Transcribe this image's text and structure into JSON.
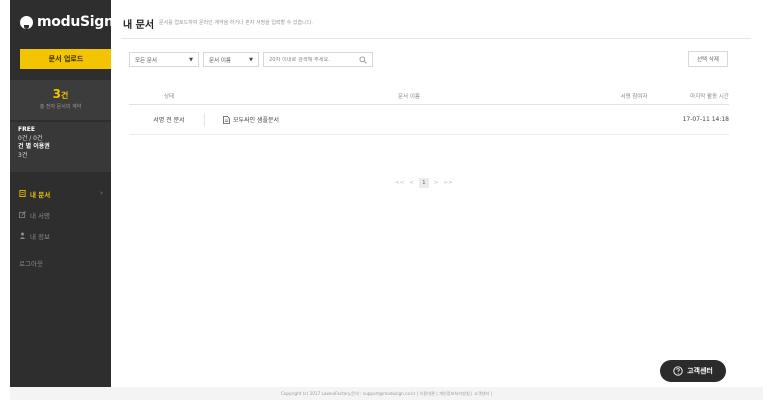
{
  "sidebar": {
    "logo_text": "moduSign",
    "upload_button": "문서 업로드",
    "stats": {
      "count": "3",
      "unit": "건",
      "label": "총 전자 문서의 계약"
    },
    "plan": {
      "name": "FREE",
      "usage": "0건 / 0건",
      "monthly_label": "건 별 이용권",
      "monthly_value": "3건"
    },
    "nav": [
      {
        "label": "내 문서",
        "icon": "document-icon",
        "active": true
      },
      {
        "label": "내 서명",
        "icon": "signature-pen-icon",
        "active": false
      },
      {
        "label": "내 정보",
        "icon": "user-icon",
        "active": false
      }
    ],
    "logout": "로그아웃"
  },
  "main": {
    "title": "내 문서",
    "subtitle": "문서를 업로드하여 온라인 계약을 하거나 혼자 서명을 입력할 수 있습니다.",
    "filters": {
      "status_select": "모든 문서",
      "field_select": "문서 이름",
      "search_placeholder": "20자 이내로 검색해 주세요."
    },
    "delete_button": "선택 삭제",
    "table": {
      "headers": {
        "status": "상태",
        "name": "문서 이름",
        "signer": "서명 참여자",
        "activity": "마지막 활동 시간"
      },
      "rows": [
        {
          "status": "서명 전 문서",
          "name": "모두싸인 샘플문서",
          "signer": "",
          "activity": "17-07-11 14:18"
        }
      ]
    },
    "pagination": {
      "first": "<<",
      "prev": "<",
      "current": "1",
      "next": ">",
      "last": ">>"
    }
  },
  "help_button": "고객센터",
  "footer": {
    "copyright": "Copyright (c) 2017 LawnoFactory.문의 : support@modusign.co.kr",
    "links": [
      "이용약관",
      "개인정보처리방침",
      "고객센터"
    ]
  },
  "colors": {
    "accent": "#f2c500",
    "sidebar_bg": "#2e2e2e"
  }
}
